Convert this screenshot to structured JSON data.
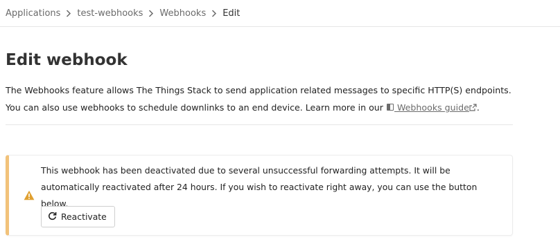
{
  "breadcrumb": {
    "items": [
      "Applications",
      "test-webhooks",
      "Webhooks",
      "Edit"
    ]
  },
  "page": {
    "title": "Edit webhook",
    "description_before_link": "The Webhooks feature allows The Things Stack to send application related messages to specific HTTP(S) endpoints. You can also use webhooks to schedule downlinks to an end device. Learn more in our",
    "link_label": "Webhooks guide",
    "description_after_link": "."
  },
  "notice": {
    "icon": "warning-icon",
    "message": "This webhook has been deactivated due to several unsuccessful forwarding attempts. It will be automatically reactivated after 24 hours. If you wish to reactivate right away, you can use the button below.",
    "button_label": "Reactivate",
    "accent_color": "#f2c27a",
    "icon_color": "#e0a030"
  }
}
